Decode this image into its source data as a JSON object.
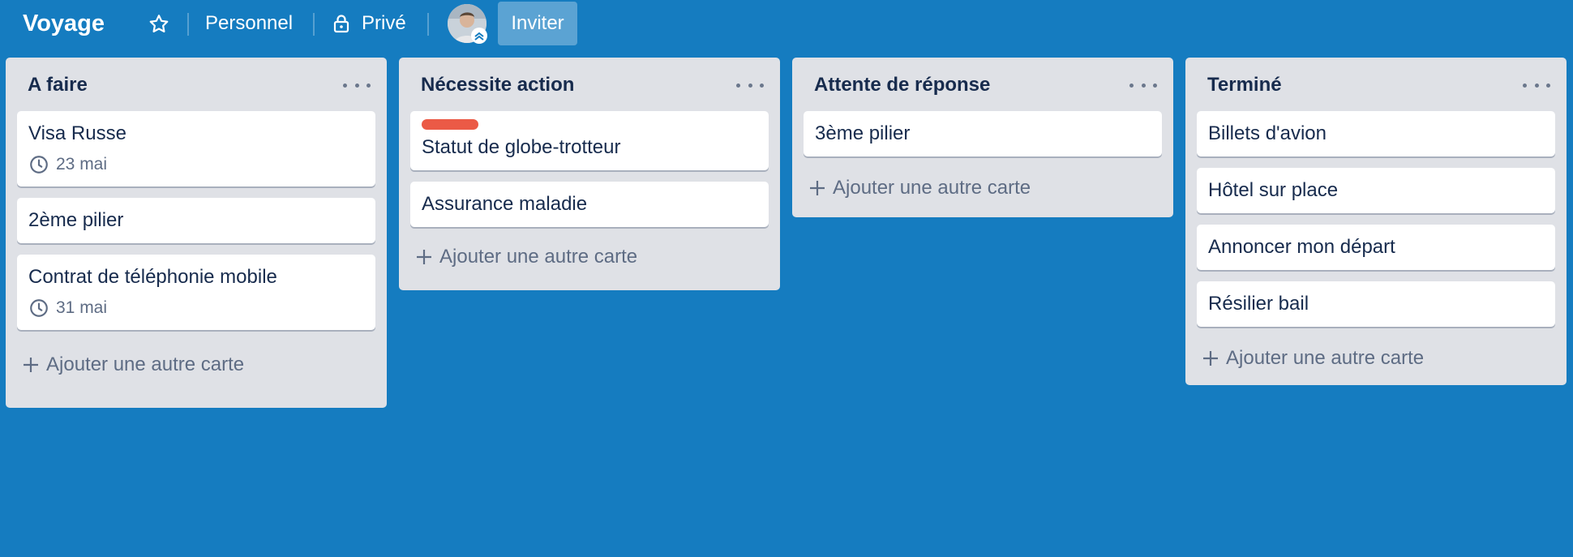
{
  "header": {
    "board_title": "Voyage",
    "star_icon": "star-icon",
    "team_label": "Personnel",
    "visibility_label": "Privé",
    "lock_icon": "lock-icon",
    "invite_label": "Inviter"
  },
  "colors": {
    "board_background": "#157cc0",
    "list_background": "#dfe1e6",
    "label_red": "#eb5a46",
    "text_dark": "#172b4d",
    "text_muted": "#5e6c84"
  },
  "lists": [
    {
      "title": "A faire",
      "cards": [
        {
          "title": "Visa Russe",
          "due": "23 mai"
        },
        {
          "title": "2ème pilier"
        },
        {
          "title": "Contrat de téléphonie mobile",
          "due": "31 mai"
        }
      ],
      "add_label": "Ajouter une autre carte"
    },
    {
      "title": "Nécessite action",
      "cards": [
        {
          "title": "Statut de globe-trotteur",
          "label_color": "red"
        },
        {
          "title": "Assurance maladie"
        }
      ],
      "add_label": "Ajouter une autre carte"
    },
    {
      "title": "Attente de réponse",
      "cards": [
        {
          "title": "3ème pilier"
        }
      ],
      "add_label": "Ajouter une autre carte"
    },
    {
      "title": "Terminé",
      "cards": [
        {
          "title": "Billets d'avion"
        },
        {
          "title": "Hôtel sur place"
        },
        {
          "title": "Annoncer mon départ"
        },
        {
          "title": "Résilier bail"
        }
      ],
      "add_label": "Ajouter une autre carte"
    }
  ]
}
